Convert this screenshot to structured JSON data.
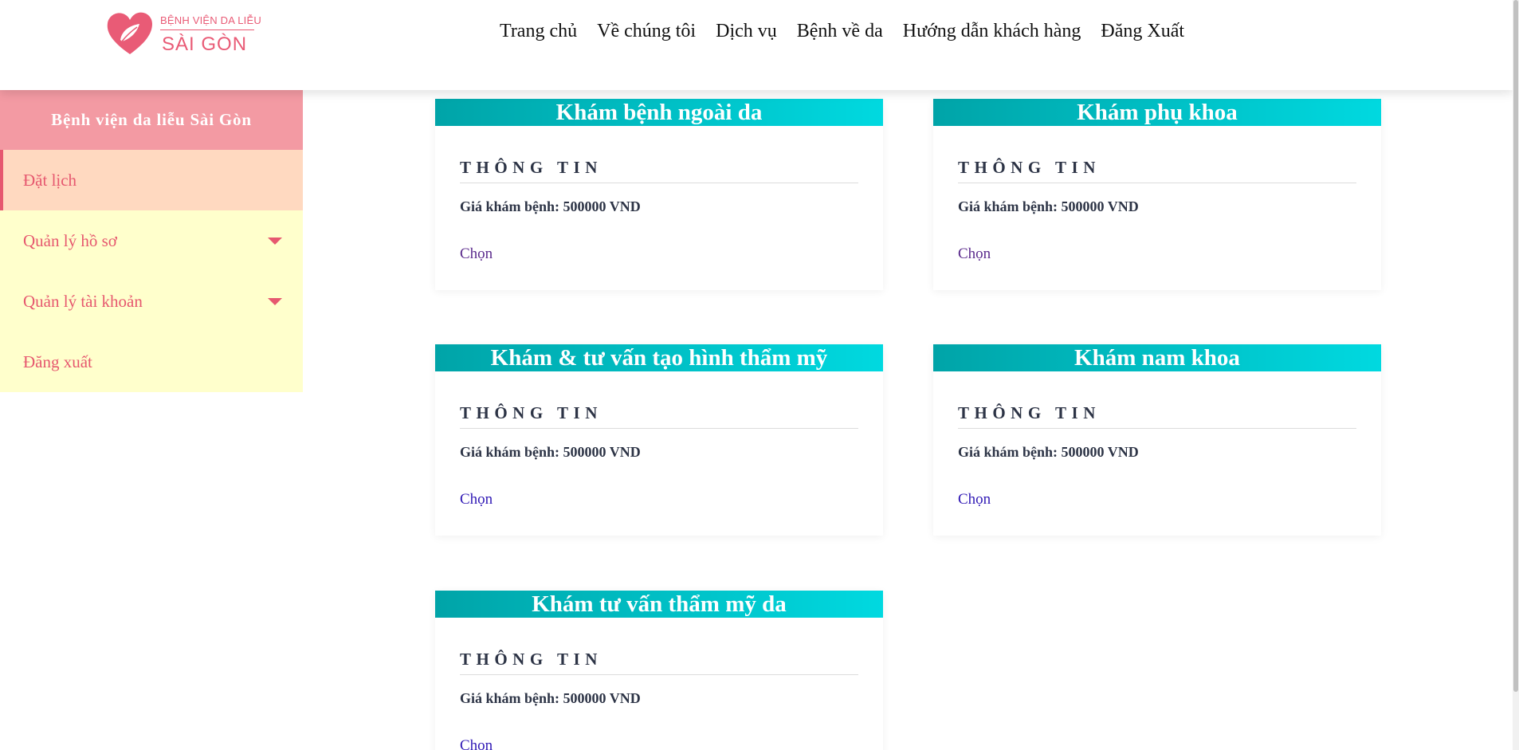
{
  "logo": {
    "line1": "BỆNH VIỆN DA LIỄU",
    "line2": "SÀI GÒN",
    "icon": "heart-leaf-icon",
    "color": "#e95b76"
  },
  "nav": {
    "items": [
      "Trang chủ",
      "Về chúng tôi",
      "Dịch vụ",
      "Bệnh về da",
      "Hướng dẫn khách hàng",
      "Đăng Xuất"
    ]
  },
  "sidebar": {
    "title": "Bệnh viện da liễu Sài Gòn",
    "items": [
      {
        "label": "Đặt lịch",
        "active": true
      },
      {
        "label": "Quản lý hồ sơ",
        "icon": "caret-down-icon"
      },
      {
        "label": "Quản lý tài khoản",
        "icon": "caret-down-icon"
      },
      {
        "label": "Đăng xuất"
      }
    ]
  },
  "cards": [
    {
      "title": "Khám bệnh ngoài da",
      "info": "THÔNG TIN",
      "price": "Giá khám bệnh: 500000 VND",
      "select": "Chọn"
    },
    {
      "title": "Khám phụ khoa",
      "info": "THÔNG TIN",
      "price": "Giá khám bệnh: 500000 VND",
      "select": "Chọn"
    },
    {
      "title": "Khám & tư vấn tạo hình thẩm mỹ",
      "info": "THÔNG TIN",
      "price": "Giá khám bệnh: 500000 VND",
      "select": "Chọn"
    },
    {
      "title": "Khám nam khoa",
      "info": "THÔNG TIN",
      "price": "Giá khám bệnh: 500000 VND",
      "select": "Chọn"
    },
    {
      "title": "Khám tư vấn thẩm mỹ da",
      "info": "THÔNG TIN",
      "price": "Giá khám bệnh: 500000 VND",
      "select": "Chọn"
    }
  ],
  "colors": {
    "accent_pink": "#e6586f",
    "sidebar_header": "#f39aa3",
    "sidebar_bg": "#ffffcc",
    "sidebar_active": "#ffd9c0",
    "card_header_start": "#00a4a8",
    "card_header_end": "#00d9e0",
    "link": "#3019b5"
  }
}
